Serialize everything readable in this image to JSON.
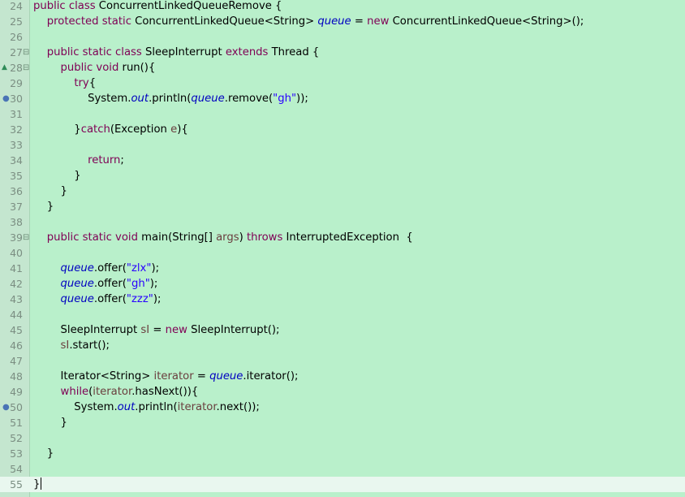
{
  "editor": {
    "language": "java",
    "current_line": 55,
    "lines": [
      {
        "n": "24",
        "tokens": [
          {
            "t": "public class",
            "c": "kw"
          },
          {
            "t": " ConcurrentLinkedQueueRemove {",
            "c": ""
          }
        ]
      },
      {
        "n": "25",
        "tokens": [
          {
            "t": "    ",
            "c": ""
          },
          {
            "t": "protected static",
            "c": "kw"
          },
          {
            "t": " ConcurrentLinkedQueue<String> ",
            "c": ""
          },
          {
            "t": "queue",
            "c": "fld"
          },
          {
            "t": " = ",
            "c": ""
          },
          {
            "t": "new",
            "c": "kw"
          },
          {
            "t": " ConcurrentLinkedQueue<String>();",
            "c": ""
          }
        ]
      },
      {
        "n": "26",
        "tokens": []
      },
      {
        "n": "27",
        "fold": true,
        "tokens": [
          {
            "t": "    ",
            "c": ""
          },
          {
            "t": "public static class",
            "c": "kw"
          },
          {
            "t": " SleepInterrupt ",
            "c": ""
          },
          {
            "t": "extends",
            "c": "kw"
          },
          {
            "t": " Thread {",
            "c": ""
          }
        ]
      },
      {
        "n": "28",
        "fold": true,
        "override": true,
        "tokens": [
          {
            "t": "        ",
            "c": ""
          },
          {
            "t": "public void",
            "c": "kw"
          },
          {
            "t": " run(){",
            "c": ""
          }
        ]
      },
      {
        "n": "29",
        "tokens": [
          {
            "t": "            ",
            "c": ""
          },
          {
            "t": "try",
            "c": "kw"
          },
          {
            "t": "{",
            "c": ""
          }
        ]
      },
      {
        "n": "30",
        "breakpoint": true,
        "tokens": [
          {
            "t": "                System.",
            "c": ""
          },
          {
            "t": "out",
            "c": "fld"
          },
          {
            "t": ".println(",
            "c": ""
          },
          {
            "t": "queue",
            "c": "fld"
          },
          {
            "t": ".remove(",
            "c": ""
          },
          {
            "t": "\"gh\"",
            "c": "str"
          },
          {
            "t": "));",
            "c": ""
          }
        ]
      },
      {
        "n": "31",
        "tokens": []
      },
      {
        "n": "32",
        "tokens": [
          {
            "t": "            }",
            "c": ""
          },
          {
            "t": "catch",
            "c": "kw"
          },
          {
            "t": "(Exception ",
            "c": ""
          },
          {
            "t": "e",
            "c": "var"
          },
          {
            "t": "){",
            "c": ""
          }
        ]
      },
      {
        "n": "33",
        "tokens": []
      },
      {
        "n": "34",
        "tokens": [
          {
            "t": "                ",
            "c": ""
          },
          {
            "t": "return",
            "c": "kw"
          },
          {
            "t": ";",
            "c": ""
          }
        ]
      },
      {
        "n": "35",
        "tokens": [
          {
            "t": "            }",
            "c": ""
          }
        ]
      },
      {
        "n": "36",
        "tokens": [
          {
            "t": "        }",
            "c": ""
          }
        ]
      },
      {
        "n": "37",
        "tokens": [
          {
            "t": "    }",
            "c": ""
          }
        ]
      },
      {
        "n": "38",
        "tokens": []
      },
      {
        "n": "39",
        "fold": true,
        "tokens": [
          {
            "t": "    ",
            "c": ""
          },
          {
            "t": "public static void",
            "c": "kw"
          },
          {
            "t": " main(String[] ",
            "c": ""
          },
          {
            "t": "args",
            "c": "var"
          },
          {
            "t": ") ",
            "c": ""
          },
          {
            "t": "throws",
            "c": "kw"
          },
          {
            "t": " InterruptedException  {",
            "c": ""
          }
        ]
      },
      {
        "n": "40",
        "tokens": []
      },
      {
        "n": "41",
        "tokens": [
          {
            "t": "        ",
            "c": ""
          },
          {
            "t": "queue",
            "c": "fld"
          },
          {
            "t": ".offer(",
            "c": ""
          },
          {
            "t": "\"zlx\"",
            "c": "str"
          },
          {
            "t": ");",
            "c": ""
          }
        ]
      },
      {
        "n": "42",
        "tokens": [
          {
            "t": "        ",
            "c": ""
          },
          {
            "t": "queue",
            "c": "fld"
          },
          {
            "t": ".offer(",
            "c": ""
          },
          {
            "t": "\"gh\"",
            "c": "str"
          },
          {
            "t": ");",
            "c": ""
          }
        ]
      },
      {
        "n": "43",
        "tokens": [
          {
            "t": "        ",
            "c": ""
          },
          {
            "t": "queue",
            "c": "fld"
          },
          {
            "t": ".offer(",
            "c": ""
          },
          {
            "t": "\"zzz\"",
            "c": "str"
          },
          {
            "t": ");",
            "c": ""
          }
        ]
      },
      {
        "n": "44",
        "tokens": []
      },
      {
        "n": "45",
        "tokens": [
          {
            "t": "        SleepInterrupt ",
            "c": ""
          },
          {
            "t": "sI",
            "c": "var"
          },
          {
            "t": " = ",
            "c": ""
          },
          {
            "t": "new",
            "c": "kw"
          },
          {
            "t": " SleepInterrupt();",
            "c": ""
          }
        ]
      },
      {
        "n": "46",
        "tokens": [
          {
            "t": "        ",
            "c": ""
          },
          {
            "t": "sI",
            "c": "var"
          },
          {
            "t": ".start();",
            "c": ""
          }
        ]
      },
      {
        "n": "47",
        "tokens": []
      },
      {
        "n": "48",
        "tokens": [
          {
            "t": "        Iterator<String> ",
            "c": ""
          },
          {
            "t": "iterator",
            "c": "var"
          },
          {
            "t": " = ",
            "c": ""
          },
          {
            "t": "queue",
            "c": "fld"
          },
          {
            "t": ".iterator();",
            "c": ""
          }
        ]
      },
      {
        "n": "49",
        "tokens": [
          {
            "t": "        ",
            "c": ""
          },
          {
            "t": "while",
            "c": "kw"
          },
          {
            "t": "(",
            "c": ""
          },
          {
            "t": "iterator",
            "c": "var"
          },
          {
            "t": ".hasNext()){",
            "c": ""
          }
        ]
      },
      {
        "n": "50",
        "breakpoint": true,
        "tokens": [
          {
            "t": "            System.",
            "c": ""
          },
          {
            "t": "out",
            "c": "fld"
          },
          {
            "t": ".println(",
            "c": ""
          },
          {
            "t": "iterator",
            "c": "var"
          },
          {
            "t": ".next());",
            "c": ""
          }
        ]
      },
      {
        "n": "51",
        "tokens": [
          {
            "t": "        }",
            "c": ""
          }
        ]
      },
      {
        "n": "52",
        "tokens": []
      },
      {
        "n": "53",
        "tokens": [
          {
            "t": "    }",
            "c": ""
          }
        ]
      },
      {
        "n": "54",
        "tokens": []
      },
      {
        "n": "55",
        "tokens": [
          {
            "t": "}",
            "c": ""
          }
        ]
      }
    ]
  }
}
